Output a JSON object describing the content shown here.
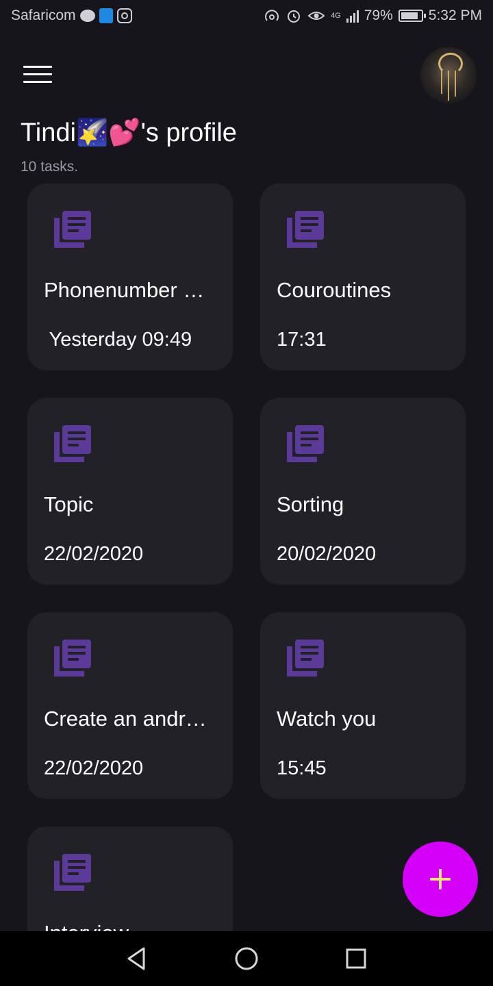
{
  "status_bar": {
    "carrier": "Safaricom",
    "network": "4G",
    "battery": "79%",
    "time": "5:32 PM",
    "icons": [
      "chat-icon",
      "shield-icon",
      "instagram-icon",
      "hotspot-icon",
      "alarm-icon",
      "eye-icon",
      "signal-icon",
      "battery-icon"
    ]
  },
  "header": {
    "title": "Tindi🌠💕's profile",
    "task_count": "10 tasks."
  },
  "tasks": [
    {
      "title": "Phonenumber …",
      "time": " Yesterday 09:49"
    },
    {
      "title": "Couroutines",
      "time": "17:31"
    },
    {
      "title": "Topic",
      "time": "22/02/2020"
    },
    {
      "title": "Sorting",
      "time": "20/02/2020"
    },
    {
      "title": "Create an andr…",
      "time": "22/02/2020"
    },
    {
      "title": "Watch you",
      "time": "15:45"
    },
    {
      "title": "Interview",
      "time": ""
    }
  ],
  "colors": {
    "background": "#16151b",
    "card": "#222128",
    "icon_accent": "#5b3a9a",
    "fab": "#d500f9",
    "fab_plus": "#f7e37a"
  },
  "fab": {
    "icon": "plus-icon"
  },
  "nav": {
    "icons": [
      "back-icon",
      "home-icon",
      "recents-icon"
    ]
  }
}
